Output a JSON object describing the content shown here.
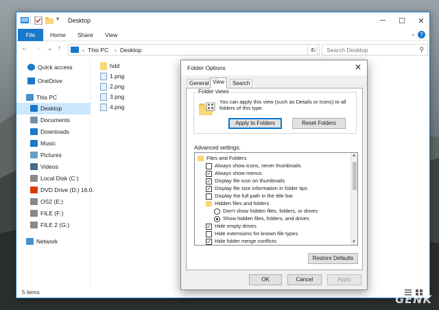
{
  "window": {
    "title": "Desktop",
    "controls": {
      "minimize": "─",
      "maximize": "☐",
      "close": "✕"
    }
  },
  "ribbon": {
    "tabs": [
      "File",
      "Home",
      "Share",
      "View"
    ],
    "expand_icon": "chevron-down-icon",
    "help_label": "?"
  },
  "address": {
    "back": "←",
    "forward": "→",
    "recent": "⌄",
    "up": "↑",
    "path": [
      "This PC",
      "Desktop"
    ],
    "separator": "›",
    "refresh": "↻",
    "search_placeholder": "Search Desktop"
  },
  "sidebar": {
    "items": [
      {
        "label": "Quick access",
        "icon": "star-icon",
        "color": "#1979ca"
      },
      {
        "label": "OneDrive",
        "icon": "cloud-icon",
        "color": "#1979ca"
      },
      {
        "label": "This PC",
        "icon": "computer-icon",
        "color": "#4a90c8"
      },
      {
        "label": "Desktop",
        "icon": "desktop-icon",
        "color": "#1979ca"
      },
      {
        "label": "Documents",
        "icon": "documents-icon",
        "color": "#7a8fa6"
      },
      {
        "label": "Downloads",
        "icon": "download-icon",
        "color": "#1979ca"
      },
      {
        "label": "Music",
        "icon": "music-icon",
        "color": "#1979ca"
      },
      {
        "label": "Pictures",
        "icon": "pictures-icon",
        "color": "#6a9fc8"
      },
      {
        "label": "Videos",
        "icon": "videos-icon",
        "color": "#4a6a8a"
      },
      {
        "label": "Local Disk (C:)",
        "icon": "drive-icon",
        "color": "#888888"
      },
      {
        "label": "DVD Drive (D:) 16.0.",
        "icon": "office-dvd-icon",
        "color": "#d83b01"
      },
      {
        "label": "OS2 (E:)",
        "icon": "drive-icon",
        "color": "#888888"
      },
      {
        "label": "FILE (F:)",
        "icon": "drive-icon",
        "color": "#888888"
      },
      {
        "label": "FILE 2 (G:)",
        "icon": "drive-icon",
        "color": "#888888"
      },
      {
        "label": "Network",
        "icon": "network-icon",
        "color": "#4a90c8"
      }
    ]
  },
  "files": [
    {
      "name": "hdd",
      "icon": "folder-icon"
    },
    {
      "name": "1.png",
      "icon": "image-file-icon"
    },
    {
      "name": "2.png",
      "icon": "image-file-icon"
    },
    {
      "name": "3.png",
      "icon": "image-file-icon"
    },
    {
      "name": "4.png",
      "icon": "image-file-icon"
    }
  ],
  "status": {
    "count": "5 items"
  },
  "dialog": {
    "title": "Folder Options",
    "close": "✕",
    "tabs": [
      "General",
      "View",
      "Search"
    ],
    "folder_views": {
      "label": "Folder views",
      "description": "You can apply this view (such as Details or Icons) to all folders of this type.",
      "apply_button": "Apply to Folders",
      "reset_button": "Reset Folders"
    },
    "advanced_label": "Advanced settings:",
    "advanced_items": [
      {
        "label": "Files and Folders",
        "kind": "folder"
      },
      {
        "label": "Always show icons, never thumbnails",
        "kind": "checkbox",
        "checked": false
      },
      {
        "label": "Always show menus",
        "kind": "checkbox",
        "checked": true
      },
      {
        "label": "Display file icon on thumbnails",
        "kind": "checkbox",
        "checked": true
      },
      {
        "label": "Display file size information in folder tips",
        "kind": "checkbox",
        "checked": true
      },
      {
        "label": "Display the full path in the title bar",
        "kind": "checkbox",
        "checked": false
      },
      {
        "label": "Hidden files and folders",
        "kind": "folder"
      },
      {
        "label": "Don't show hidden files, folders, or drives",
        "kind": "radio",
        "checked": false
      },
      {
        "label": "Show hidden files, folders, and drives",
        "kind": "radio",
        "checked": true
      },
      {
        "label": "Hide empty drives",
        "kind": "checkbox",
        "checked": true
      },
      {
        "label": "Hide extensions for known file types",
        "kind": "checkbox",
        "checked": false
      },
      {
        "label": "Hide folder merge conflicts",
        "kind": "checkbox",
        "checked": true
      }
    ],
    "restore_button": "Restore Defaults",
    "ok_button": "OK",
    "cancel_button": "Cancel",
    "apply_button": "Apply"
  },
  "watermark": "GENK",
  "colors": {
    "accent": "#1979ca",
    "selection": "#cce8ff",
    "folder": "#f8d775"
  }
}
